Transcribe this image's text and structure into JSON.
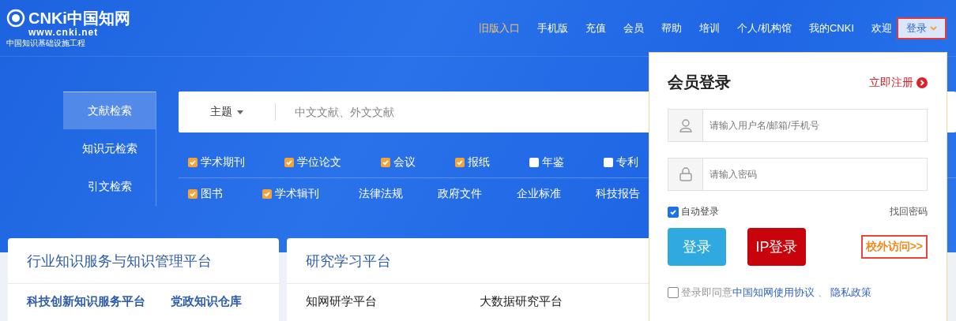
{
  "logo": {
    "brand": "CNKi中国知网",
    "url": "www.cnki.net",
    "slogan": "中国知识基础设施工程"
  },
  "nav": [
    {
      "label": "旧版入口",
      "highlight": true
    },
    {
      "label": "手机版",
      "highlight": false
    },
    {
      "label": "充值",
      "highlight": false
    },
    {
      "label": "会员",
      "highlight": false
    },
    {
      "label": "帮助",
      "highlight": false
    },
    {
      "label": "培训",
      "highlight": false
    },
    {
      "label": "个人/机构馆",
      "highlight": false
    },
    {
      "label": "我的CNKI",
      "highlight": false
    },
    {
      "label": "欢迎",
      "highlight": false
    }
  ],
  "login_toggle": {
    "label": "登录",
    "expanded": true
  },
  "search_tabs": [
    {
      "label": "文献检索",
      "selected": true
    },
    {
      "label": "知识元检索",
      "selected": false
    },
    {
      "label": "引文检索",
      "selected": false
    }
  ],
  "search": {
    "field": "主题",
    "placeholder": "中文文献、外文文献"
  },
  "sources": [
    [
      {
        "kind": "checkbox",
        "label": "学术期刊",
        "checked": true
      },
      {
        "kind": "checkbox",
        "label": "学位论文",
        "checked": true
      },
      {
        "kind": "checkbox",
        "label": "会议",
        "checked": true
      },
      {
        "kind": "checkbox",
        "label": "报纸",
        "checked": true
      },
      {
        "kind": "checkbox",
        "label": "年鉴",
        "checked": false
      },
      {
        "kind": "checkbox",
        "label": "专利",
        "checked": false
      }
    ],
    [
      {
        "kind": "checkbox",
        "label": "图书",
        "checked": true
      },
      {
        "kind": "checkbox",
        "label": "学术辑刊",
        "checked": true
      },
      {
        "kind": "link",
        "label": "法律法规"
      },
      {
        "kind": "link",
        "label": "政府文件"
      },
      {
        "kind": "link",
        "label": "企业标准"
      },
      {
        "kind": "link",
        "label": "科技报告"
      }
    ]
  ],
  "cards": [
    {
      "title": "行业知识服务与知识管理平台",
      "links": [
        "科技创新知识服务平台",
        "党政知识仓库"
      ],
      "bold": true
    },
    {
      "title": "研究学习平台",
      "links": [
        "知网研学平台",
        "大数据研究平台"
      ],
      "bold": false
    }
  ],
  "login_panel": {
    "title": "会员登录",
    "register": "立即注册",
    "username_placeholder": "请输入用户名/邮箱/手机号",
    "password_placeholder": "请输入密码",
    "auto_login": {
      "label": "自动登录",
      "checked": true
    },
    "forgot": "找回密码",
    "login_button": "登录",
    "ip_login_button": "IP登录",
    "offsite": "校外访问>>",
    "agree": {
      "checked": false,
      "prefix": "登录即同意",
      "terms": "中国知网使用协议",
      "separator": "、",
      "privacy": "隐私政策"
    }
  }
}
